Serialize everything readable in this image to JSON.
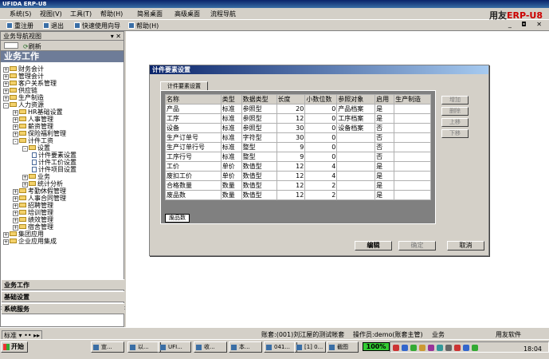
{
  "app": {
    "title": "UFIDA ERP-U8",
    "brand_prefix": "用友",
    "brand_main": "ERP-U8"
  },
  "menu": [
    "系统(S)",
    "视图(V)",
    "工具(T)",
    "帮助(H)",
    "简易桌面",
    "高级桌面",
    "流程导航"
  ],
  "toolbar": {
    "relogin": "重注册",
    "exit": "退出",
    "wizard": "快速使用向导",
    "help": "帮助(H)"
  },
  "nav": {
    "header": "业务导航视图",
    "refresh": "刷新",
    "title": "业务工作",
    "tree": [
      {
        "label": "财务会计",
        "level": 0,
        "expand": "+",
        "icon": "folder"
      },
      {
        "label": "管理会计",
        "level": 0,
        "expand": "+",
        "icon": "folder"
      },
      {
        "label": "客户关系管理",
        "level": 0,
        "expand": "+",
        "icon": "folder"
      },
      {
        "label": "供应链",
        "level": 0,
        "expand": "+",
        "icon": "folder"
      },
      {
        "label": "生产制造",
        "level": 0,
        "expand": "+",
        "icon": "folder"
      },
      {
        "label": "人力资源",
        "level": 0,
        "expand": "-",
        "icon": "folder"
      },
      {
        "label": "HR基础设置",
        "level": 1,
        "expand": "+",
        "icon": "folder"
      },
      {
        "label": "人事管理",
        "level": 1,
        "expand": "+",
        "icon": "folder"
      },
      {
        "label": "薪资管理",
        "level": 1,
        "expand": "+",
        "icon": "folder"
      },
      {
        "label": "保险福利管理",
        "level": 1,
        "expand": "+",
        "icon": "folder"
      },
      {
        "label": "计件工资",
        "level": 1,
        "expand": "-",
        "icon": "folder"
      },
      {
        "label": "设置",
        "level": 2,
        "expand": "-",
        "icon": "folder"
      },
      {
        "label": "计件要素设置",
        "level": 3,
        "expand": "",
        "icon": "doc"
      },
      {
        "label": "计件工价设置",
        "level": 3,
        "expand": "",
        "icon": "doc"
      },
      {
        "label": "计件项目设置",
        "level": 3,
        "expand": "",
        "icon": "doc"
      },
      {
        "label": "业务",
        "level": 2,
        "expand": "+",
        "icon": "folder"
      },
      {
        "label": "统计分析",
        "level": 2,
        "expand": "+",
        "icon": "folder"
      },
      {
        "label": "考勤休假管理",
        "level": 1,
        "expand": "+",
        "icon": "folder"
      },
      {
        "label": "人事合同管理",
        "level": 1,
        "expand": "+",
        "icon": "folder"
      },
      {
        "label": "招聘管理",
        "level": 1,
        "expand": "+",
        "icon": "folder"
      },
      {
        "label": "培训管理",
        "level": 1,
        "expand": "+",
        "icon": "folder"
      },
      {
        "label": "绩效管理",
        "level": 1,
        "expand": "+",
        "icon": "folder"
      },
      {
        "label": "宿舍管理",
        "level": 1,
        "expand": "+",
        "icon": "folder"
      },
      {
        "label": "集团应用",
        "level": 0,
        "expand": "+",
        "icon": "folder"
      },
      {
        "label": "企业应用集成",
        "level": 0,
        "expand": "+",
        "icon": "folder"
      }
    ],
    "sections": [
      "业务工作",
      "基础设置",
      "系统服务"
    ],
    "foot_label": "标准"
  },
  "dialog": {
    "title": "计件要素设置",
    "tab": "计件要素设置",
    "columns": [
      "名称",
      "类型",
      "数据类型",
      "长度",
      "小数位数",
      "参照对象",
      "启用",
      "生产制造"
    ],
    "rows": [
      [
        "产品",
        "标准",
        "参照型",
        "20",
        "0",
        "产品档案",
        "是",
        ""
      ],
      [
        "工序",
        "标准",
        "参照型",
        "12",
        "0",
        "工序档案",
        "是",
        ""
      ],
      [
        "设备",
        "标准",
        "参照型",
        "30",
        "0",
        "设备档案",
        "否",
        ""
      ],
      [
        "生产订单号",
        "标准",
        "字符型",
        "30",
        "0",
        "",
        "否",
        ""
      ],
      [
        "生产订单行号",
        "标准",
        "整型",
        "9",
        "0",
        "",
        "否",
        ""
      ],
      [
        "工序行号",
        "标准",
        "整型",
        "9",
        "0",
        "",
        "否",
        ""
      ],
      [
        "工价",
        "单价",
        "数值型",
        "12",
        "4",
        "",
        "是",
        ""
      ],
      [
        "废扣工价",
        "单价",
        "数值型",
        "12",
        "4",
        "",
        "是",
        ""
      ],
      [
        "合格数量",
        "数量",
        "数值型",
        "12",
        "2",
        "",
        "是",
        ""
      ],
      [
        "废品数",
        "数量",
        "数值型",
        "12",
        "2",
        "",
        "是",
        ""
      ]
    ],
    "scrap_label": "废品数",
    "side_buttons": [
      "增加",
      "删除",
      "上移",
      "下移"
    ],
    "edit": "编辑",
    "ok": "确定",
    "cancel": "取消"
  },
  "status": {
    "account": "账套:(001)刘江屋的测试帐套",
    "operator": "操作员:demo(账套主管)",
    "business": "业务",
    "vendor": "用友软件"
  },
  "taskbar": {
    "start": "开始",
    "tasks": [
      "宣...",
      "以...",
      "UFI...",
      "收...",
      "本...",
      "041...",
      "[1] 0...",
      "截图"
    ],
    "battery": "100%",
    "clock": "18:04"
  }
}
